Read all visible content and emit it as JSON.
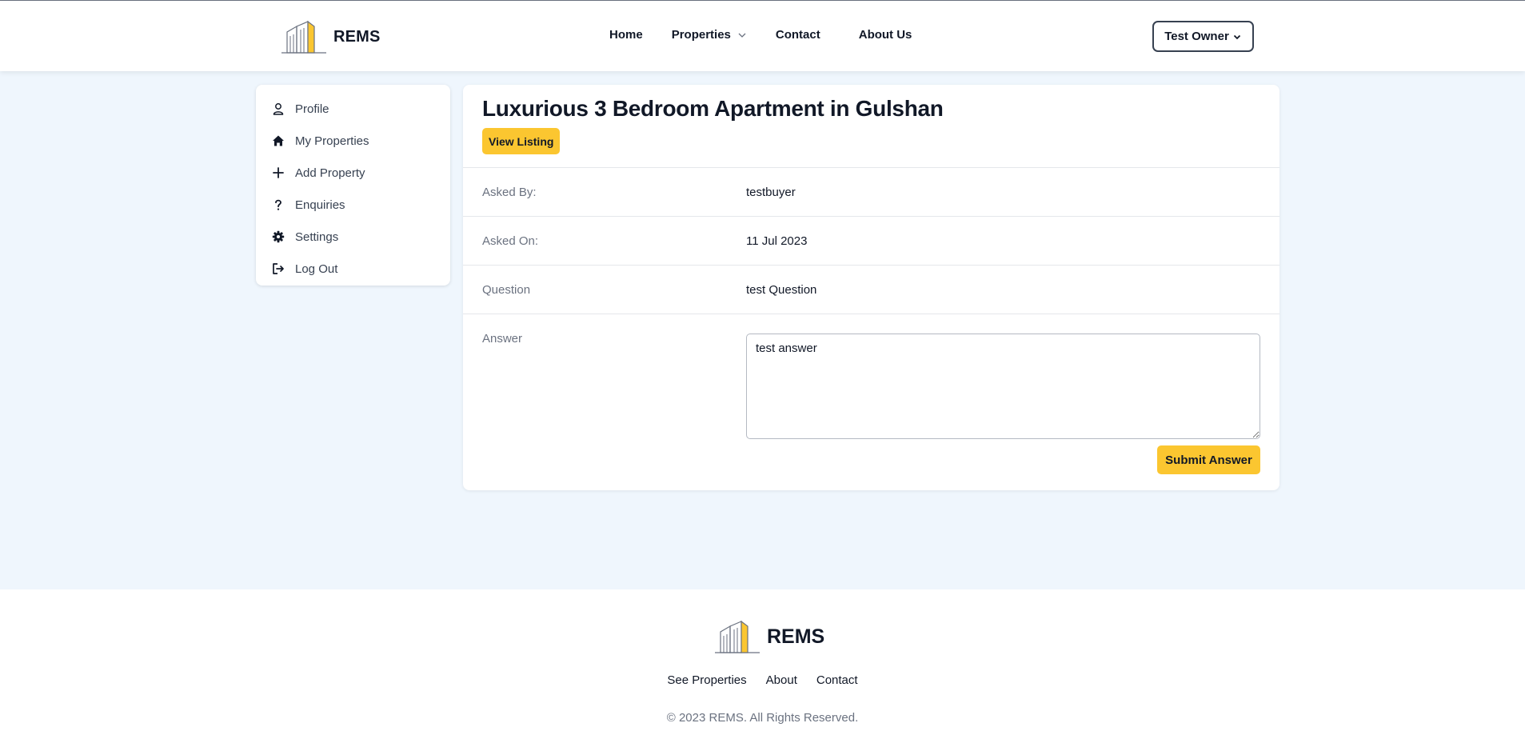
{
  "header": {
    "brand": "REMS",
    "nav": {
      "home": "Home",
      "properties": "Properties",
      "contact": "Contact",
      "about": "About Us"
    },
    "user_menu_label": "Test Owner"
  },
  "sidebar": {
    "items": [
      {
        "label": "Profile",
        "icon": "user-icon"
      },
      {
        "label": "My Properties",
        "icon": "home-icon"
      },
      {
        "label": "Add Property",
        "icon": "plus-icon"
      },
      {
        "label": "Enquiries",
        "icon": "question-icon"
      },
      {
        "label": "Settings",
        "icon": "gear-icon"
      },
      {
        "label": "Log Out",
        "icon": "logout-icon"
      }
    ]
  },
  "enquiry": {
    "title": "Luxurious 3 Bedroom Apartment in Gulshan",
    "view_listing_label": "View Listing",
    "fields": [
      {
        "label": "Asked By:",
        "value": "testbuyer"
      },
      {
        "label": "Asked On:",
        "value": "11 Jul 2023"
      },
      {
        "label": "Question",
        "value": "test Question"
      }
    ],
    "answer_label": "Answer",
    "answer_value": "test answer",
    "submit_label": "Submit Answer"
  },
  "footer": {
    "brand": "REMS",
    "links": [
      "See Properties",
      "About",
      "Contact"
    ],
    "copyright": "© 2023 REMS. All Rights Reserved."
  },
  "colors": {
    "accent": "#fbc630",
    "page_background": "#eff6fd",
    "card_background": "#ffffff",
    "text_primary": "#111827",
    "text_muted": "#6b7280"
  }
}
